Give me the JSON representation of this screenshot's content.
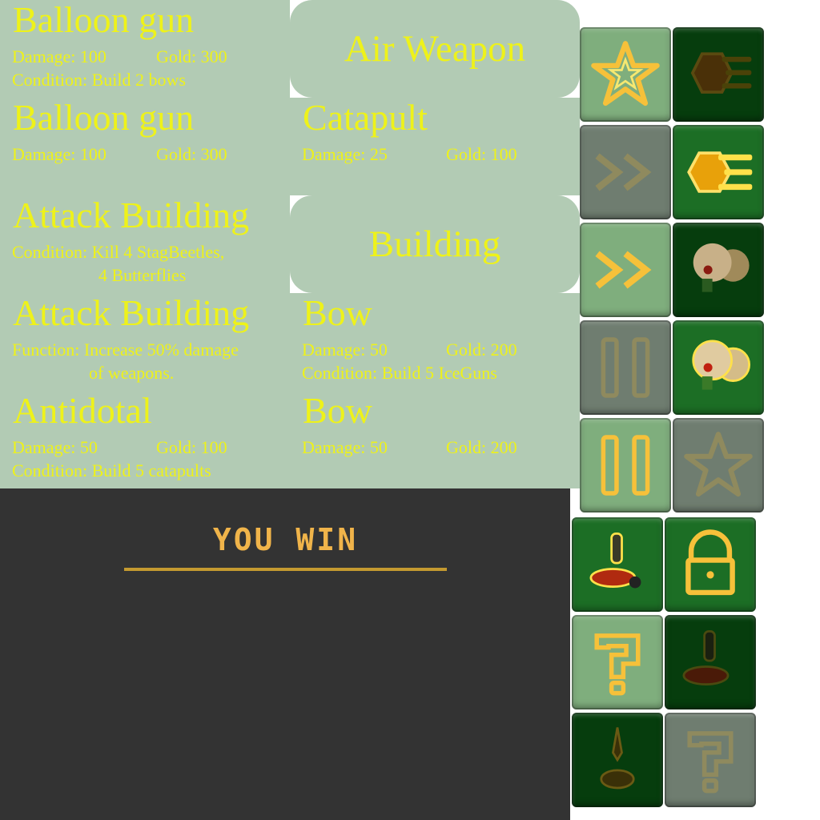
{
  "tabs": {
    "air": "Air Weapon",
    "building": "Building"
  },
  "cards": [
    {
      "title": "Balloon gun",
      "damage": "Damage: 100",
      "gold": "Gold: 300",
      "line2": "Condition:  Build 2 bows"
    },
    {
      "title": "Balloon gun",
      "damage": "Damage: 100",
      "gold": "Gold: 300"
    },
    {
      "title": "Catapult",
      "damage": "Damage: 25",
      "gold": "Gold: 100"
    },
    {
      "title": "Attack Building",
      "line1": "Condition: Kill 4 StagBeetles,",
      "line2": "4 Butterflies"
    },
    {
      "title": "Attack Building",
      "line1": "Function: Increase 50% damage",
      "line2": "of weapons."
    },
    {
      "title": "Bow",
      "damage": "Damage: 50",
      "gold": "Gold: 200",
      "line2": "Condition: Build 5 IceGuns"
    },
    {
      "title": "Antidotal",
      "damage": "Damage: 50",
      "gold": "Gold: 100",
      "line2": "Condition:  Build 5 catapults"
    },
    {
      "title": "Bow",
      "damage": "Damage: 50",
      "gold": "Gold: 200"
    }
  ],
  "win_text": "YOU WIN",
  "tiles": [
    {
      "icon": "star-icon",
      "style": "light-green",
      "active": true
    },
    {
      "icon": "hexagon-speed-icon",
      "style": "dark-green",
      "active": false
    },
    {
      "icon": "fast-forward-icon",
      "style": "gray",
      "active": false
    },
    {
      "icon": "hexagon-speed-icon",
      "style": "green",
      "active": true
    },
    {
      "icon": "fast-forward-icon",
      "style": "light-green",
      "active": true
    },
    {
      "icon": "rock-monster-icon",
      "style": "dark-green",
      "active": false
    },
    {
      "icon": "pause-icon",
      "style": "gray",
      "active": false
    },
    {
      "icon": "rock-monster-icon",
      "style": "green",
      "active": true
    },
    {
      "icon": "pause-icon",
      "style": "light-green",
      "active": true
    },
    {
      "icon": "star-icon",
      "style": "gray",
      "active": false
    },
    {
      "icon": "ant-cannon-icon",
      "style": "green",
      "active": true
    },
    {
      "icon": "lock-icon",
      "style": "green",
      "active": true
    },
    {
      "icon": "question-icon",
      "style": "light-green",
      "active": true
    },
    {
      "icon": "ant-cannon-icon",
      "style": "dark-green",
      "active": false
    },
    {
      "icon": "ant-sword-icon",
      "style": "dark-green",
      "active": false
    },
    {
      "icon": "question-icon",
      "style": "gray",
      "active": false
    }
  ],
  "colors": {
    "panel": "#b2cbb4",
    "text": "#eef21a",
    "dark_bg": "#333333",
    "win": "#f0b44a"
  }
}
